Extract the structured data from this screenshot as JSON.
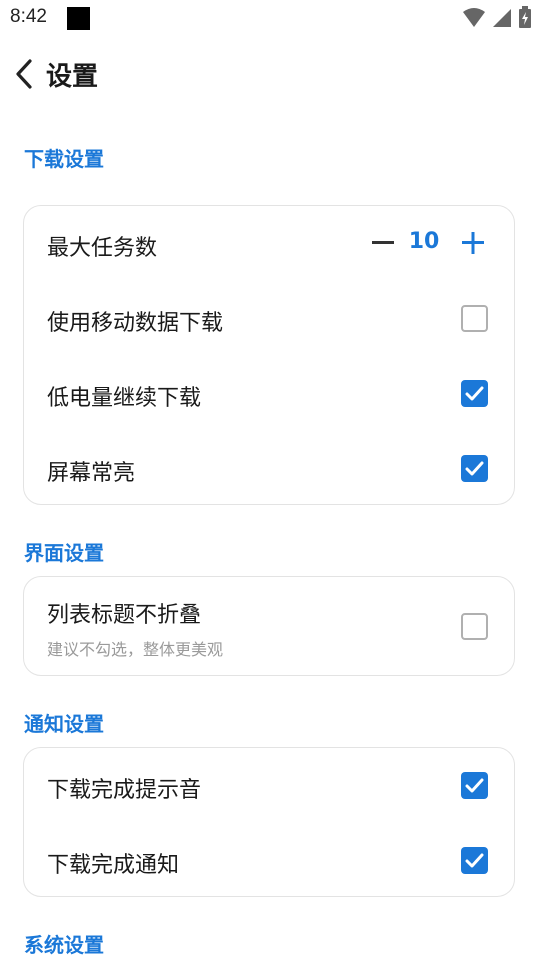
{
  "status_bar": {
    "time": "8:42",
    "icons": [
      "wifi-icon",
      "signal-icon",
      "battery-icon"
    ]
  },
  "header": {
    "title": "设置",
    "back_icon": "chevron-left-icon"
  },
  "sections": {
    "download": {
      "title": "下载设置",
      "max_tasks": {
        "label": "最大任务数",
        "value": "10"
      },
      "mobile_data": {
        "label": "使用移动数据下载",
        "checked": false
      },
      "low_battery": {
        "label": "低电量继续下载",
        "checked": true
      },
      "screen_on": {
        "label": "屏幕常亮",
        "checked": true
      }
    },
    "interface": {
      "title": "界面设置",
      "no_fold": {
        "label": "列表标题不折叠",
        "subtitle": "建议不勾选，整体更美观",
        "checked": false
      }
    },
    "notification": {
      "title": "通知设置",
      "sound": {
        "label": "下载完成提示音",
        "checked": true
      },
      "notify": {
        "label": "下载完成通知",
        "checked": true
      }
    },
    "system": {
      "title": "系统设置"
    }
  },
  "colors": {
    "accent": "#1b78d8",
    "checkbox_off_border": "#b0b0b0",
    "card_border": "#e3e3e3"
  }
}
